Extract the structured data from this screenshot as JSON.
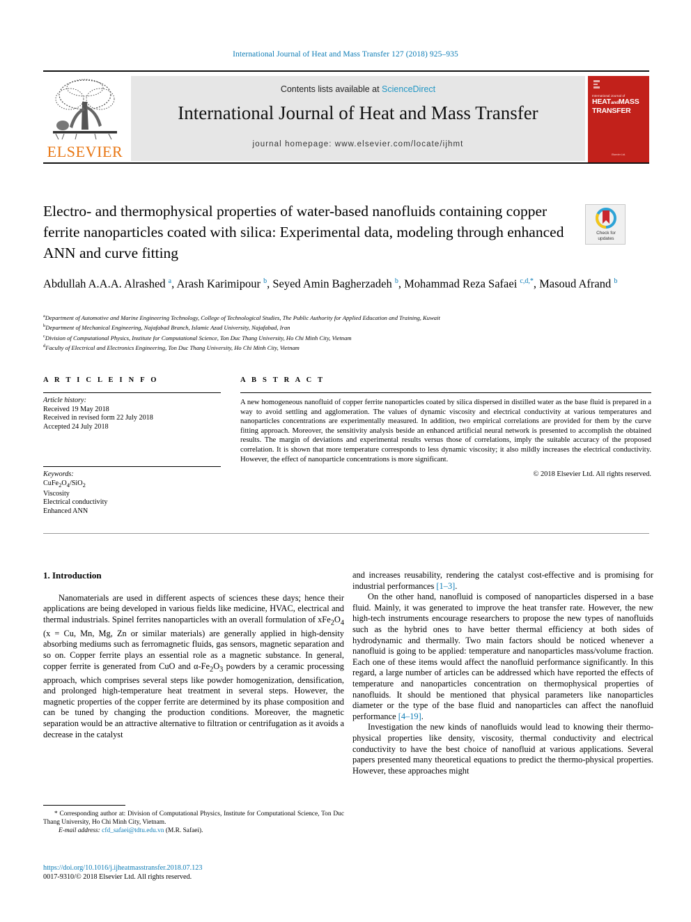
{
  "running_head": "International Journal of Heat and Mass Transfer 127 (2018) 925–935",
  "masthead": {
    "contents_prefix": "Contents lists available at ",
    "sciencedirect": "ScienceDirect",
    "journal_title": "International Journal of Heat and Mass Transfer",
    "homepage": "journal homepage: www.elsevier.com/locate/ijhmt",
    "publisher_logo_text": "ELSEVIER",
    "cover": {
      "subtitle": "International Journal of",
      "line1": "HEAT",
      "line1b": "and",
      "line1c": "MASS",
      "line2": "TRANSFER",
      "footer": "Elsevier Ltd."
    },
    "accent_orange": "#e87511",
    "accent_blue": "#2196c4",
    "cover_red": "#c2211b"
  },
  "article": {
    "title": "Electro- and thermophysical properties of water-based nanofluids containing copper ferrite nanoparticles coated with silica: Experimental data, modeling through enhanced ANN and curve fitting",
    "crossmark_label_line1": "Check for",
    "crossmark_label_line2": "updates",
    "authors_html": "Abdullah A.A.A. Alrashed <sup>a</sup>, Arash Karimipour <sup>b</sup>, Seyed Amin Bagherzadeh <sup>b</sup>, Mohammad Reza Safaei <sup>c,d,</sup><sup>*</sup>, Masoud Afrand <sup>b</sup>",
    "affiliations": [
      "Department of Automotive and Marine Engineering Technology, College of Technological Studies, The Public Authority for Applied Education and Training, Kuwait",
      "Department of Mechanical Engineering, Najafabad Branch, Islamic Azad University, Najafabad, Iran",
      "Division of Computational Physics, Institute for Computational Science, Ton Duc Thang University, Ho Chi Minh City, Vietnam",
      "Faculty of Electrical and Electronics Engineering, Ton Duc Thang University, Ho Chi Minh City, Vietnam"
    ],
    "affiliation_marks": [
      "a",
      "b",
      "c",
      "d"
    ]
  },
  "article_info": {
    "heading": "A R T I C L E    I N F O",
    "history_label": "Article history:",
    "history": [
      "Received 19 May 2018",
      "Received in revised form 22 July 2018",
      "Accepted 24 July 2018"
    ],
    "keywords_label": "Keywords:",
    "keywords_html": [
      "CuFe<sub>2</sub>O<sub>4</sub>/SiO<sub>2</sub>",
      "Viscosity",
      "Electrical conductivity",
      "Enhanced ANN"
    ]
  },
  "abstract": {
    "heading": "A B S T R A C T",
    "text": "A new homogeneous nanofluid of copper ferrite nanoparticles coated by silica dispersed in distilled water as the base fluid is prepared in a way to avoid settling and agglomeration. The values of dynamic viscosity and electrical conductivity at various temperatures and nanoparticles concentrations are experimentally measured. In addition, two empirical correlations are provided for them by the curve fitting approach. Moreover, the sensitivity analysis beside an enhanced artificial neural network is presented to accomplish the obtained results. The margin of deviations and experimental results versus those of correlations, imply the suitable accuracy of the proposed correlation. It is shown that more temperature corresponds to less dynamic viscosity; it also mildly increases the electrical conductivity. However, the effect of nanoparticle concentrations is more significant.",
    "copyright": "© 2018 Elsevier Ltd. All rights reserved."
  },
  "body": {
    "section_heading": "1. Introduction",
    "left_paragraph_html": "Nanomaterials are used in different aspects of sciences these days; hence their applications are being developed in various fields like medicine, HVAC, electrical and thermal industrials. Spinel ferrites nanoparticles with an overall formulation of xFe<sub>2</sub>O<sub>4</sub> (x = Cu, Mn, Mg, Zn or similar materials) are generally applied in high-density absorbing mediums such as ferromagnetic fluids, gas sensors, magnetic separation and so on. Copper ferrite plays an essential role as a magnetic substance. In general, copper ferrite is generated from CuO and α-Fe<sub>2</sub>O<sub>3</sub> powders by a ceramic processing approach, which comprises several steps like powder homogenization, densification, and prolonged high-temperature heat treatment in several steps. However, the magnetic properties of the copper ferrite are determined by its phase composition and can be tuned by changing the production conditions. Moreover, the magnetic separation would be an attractive alternative to filtration or centrifugation as it avoids a decrease in the catalyst",
    "right_paragraph_1_html": "and increases reusability, rendering the catalyst cost-effective and is promising for industrial performances <span class=\"ref\">[1–3]</span>.",
    "right_paragraph_2_html": "On the other hand, nanofluid is composed of nanoparticles dispersed in a base fluid. Mainly, it was generated to improve the heat transfer rate. However, the new high-tech instruments encourage researchers to propose the new types of nanofluids such as the hybrid ones to have better thermal efficiency at both sides of hydrodynamic and thermally. Two main factors should be noticed whenever a nanofluid is going to be applied: temperature and nanoparticles mass/volume fraction. Each one of these items would affect the nanofluid performance significantly. In this regard, a large number of articles can be addressed which have reported the effects of temperature and nanoparticles concentration on thermophysical properties of nanofluids. It should be mentioned that physical parameters like nanoparticles diameter or the type of the base fluid and nanoparticles can affect the nanofluid performance <span class=\"ref\">[4–19]</span>.",
    "right_paragraph_3_html": "Investigation the new kinds of nanofluids would lead to knowing their thermo-physical properties like density, viscosity, thermal conductivity and electrical conductivity to have the best choice of nanofluid at various applications. Several papers presented many theoretical equations to predict the thermo-physical properties. However, these approaches might"
  },
  "footnote": {
    "corresponding_html": "<span class=\"lead\">* Corresponding author at: Division of Computational Physics, Institute for Computational Science, Ton Duc Thang University, Ho Chi Minh City, Vietnam.</span>",
    "email_label": "E-mail address:",
    "email": "cfd_safaei@tdtu.edu.vn",
    "email_suffix": "(M.R. Safaei).",
    "doi": "https://doi.org/10.1016/j.ijheatmasstransfer.2018.07.123",
    "issn_line": "0017-9310/© 2018 Elsevier Ltd. All rights reserved."
  }
}
